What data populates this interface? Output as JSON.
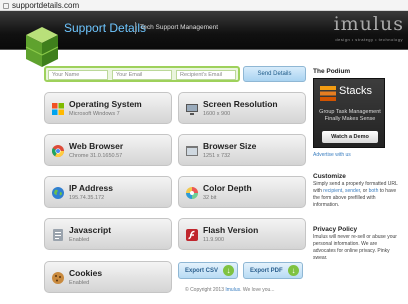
{
  "browser": {
    "url": "supportdetails.com"
  },
  "header": {
    "title": "Support Details",
    "subtitle": "Tech Support Management",
    "brand": "imulus",
    "brand_tagline": "design • strategy • technology"
  },
  "form": {
    "name_placeholder": "Your Name",
    "email_placeholder": "Your Email",
    "recipient_placeholder": "Recipient's Email",
    "send_label": "Send Details"
  },
  "tiles": {
    "os": {
      "title": "Operating System",
      "value": "Microsoft Windows 7"
    },
    "resolution": {
      "title": "Screen Resolution",
      "value": "1600 x 900"
    },
    "browser": {
      "title": "Web Browser",
      "value": "Chrome 31.0.1650.57"
    },
    "browser_size": {
      "title": "Browser Size",
      "value": "1251 x 732"
    },
    "ip": {
      "title": "IP Address",
      "value": "195.74.35.172"
    },
    "color_depth": {
      "title": "Color Depth",
      "value": "32 bit"
    },
    "javascript": {
      "title": "Javascript",
      "value": "Enabled"
    },
    "flash": {
      "title": "Flash Version",
      "value": "11.9.900"
    },
    "cookies": {
      "title": "Cookies",
      "value": "Enabled"
    }
  },
  "export": {
    "csv": "Export CSV",
    "pdf": "Export PDF"
  },
  "footer": {
    "copyright": "© Copyright 2013",
    "brand": "Imulus",
    "tail": ". We love you..."
  },
  "sidebar": {
    "podium_heading": "The Podium",
    "ad": {
      "name": "Stacks",
      "line1": "Group Task Management",
      "line2": "Finally Makes Sense",
      "button": "Watch a Demo"
    },
    "advertise": "Advertise with us",
    "customize_heading": "Customize",
    "customize_text_1": "Simply send a properly formatted URL with",
    "customize_link_1": "recipient",
    "customize_text_2": ",",
    "customize_link_2": "sender",
    "customize_text_3": ", or",
    "customize_link_3": "both",
    "customize_text_4": "to have the form above prefilled with information.",
    "privacy_heading": "Privacy Policy",
    "privacy_text": "Imulus will never re-sell or abuse your personal information. We are advocates for online privacy. Pinky swear."
  },
  "colors": {
    "accent_green": "#9ed15b",
    "header_blue": "#6ec6ff",
    "link_blue": "#3a7ec0"
  }
}
